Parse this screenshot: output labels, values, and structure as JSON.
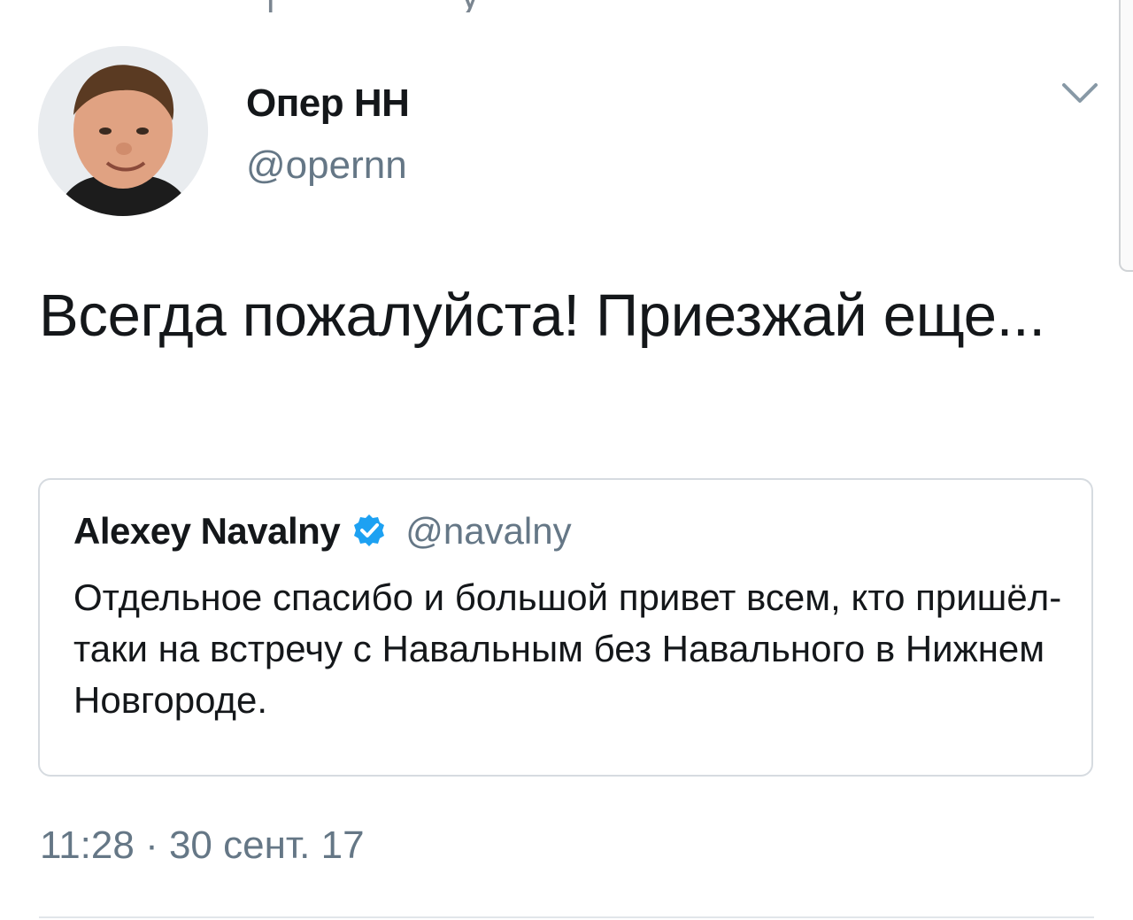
{
  "colors": {
    "text_primary": "#14171a",
    "text_secondary": "#657786",
    "verified_blue": "#1da1f2",
    "card_border": "#d6dbe0"
  },
  "tweet": {
    "author": {
      "display_name": "Опер НН",
      "handle": "@opernn",
      "avatar_icon": "avatar-photo"
    },
    "menu_icon": "chevron-down-icon",
    "text": "Всегда пожалуйста! Приезжай еще...",
    "timestamp": "11:28 · 30 сент. 17"
  },
  "quoted_tweet": {
    "display_name": "Alexey Navalny",
    "verified_icon": "verified-badge-icon",
    "handle": "@navalny",
    "text": "Отдельное спасибо и большой привет всем, кто пришёл-таки на встречу с Навальным без Навального в Нижнем Новгороде."
  }
}
